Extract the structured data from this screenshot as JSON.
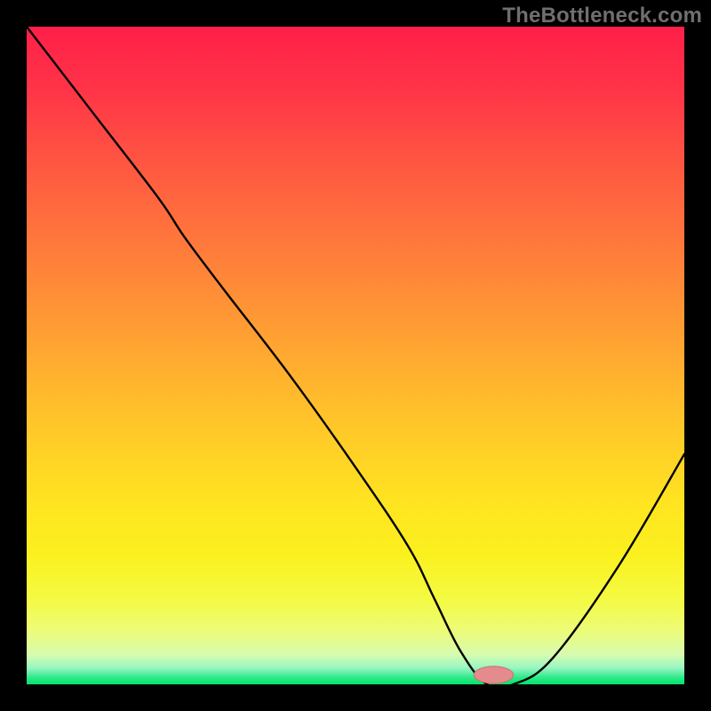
{
  "watermark": "TheBottleneck.com",
  "colors": {
    "frame": "#000000",
    "curve": "#000000",
    "marker_fill": "#e58a8d",
    "marker_stroke": "#cc6e72",
    "gradient_stops": [
      {
        "offset": 0.0,
        "color": "#ff1f49"
      },
      {
        "offset": 0.1,
        "color": "#ff3547"
      },
      {
        "offset": 0.22,
        "color": "#ff5a41"
      },
      {
        "offset": 0.35,
        "color": "#ff7e3a"
      },
      {
        "offset": 0.48,
        "color": "#ffa332"
      },
      {
        "offset": 0.6,
        "color": "#ffc52a"
      },
      {
        "offset": 0.72,
        "color": "#ffe321"
      },
      {
        "offset": 0.8,
        "color": "#fbf01e"
      },
      {
        "offset": 0.87,
        "color": "#f4fa42"
      },
      {
        "offset": 0.92,
        "color": "#ecfc7a"
      },
      {
        "offset": 0.955,
        "color": "#d7fcb0"
      },
      {
        "offset": 0.975,
        "color": "#98f6c3"
      },
      {
        "offset": 0.99,
        "color": "#2de887"
      },
      {
        "offset": 1.0,
        "color": "#00e46b"
      }
    ]
  },
  "chart_data": {
    "type": "line",
    "title": "",
    "xlabel": "",
    "ylabel": "",
    "xlim": [
      0,
      100
    ],
    "ylim": [
      0,
      100
    ],
    "grid": false,
    "x": [
      0,
      10,
      20,
      24,
      30,
      40,
      50,
      58,
      62,
      66,
      70,
      74,
      80,
      90,
      100
    ],
    "values": [
      100,
      87,
      74,
      68,
      60,
      47,
      33,
      21,
      13,
      5,
      0,
      0,
      4,
      18,
      35
    ],
    "marker": {
      "x": 71,
      "y": 0,
      "rx": 3.0,
      "ry": 1.3
    },
    "notes": "y represents bottleneck percentage (height above baseline); minimum (optimal) occurs around x≈70-74; heat gradient encodes same percentage vertically (green=0 at bottom, red=100 at top)."
  }
}
